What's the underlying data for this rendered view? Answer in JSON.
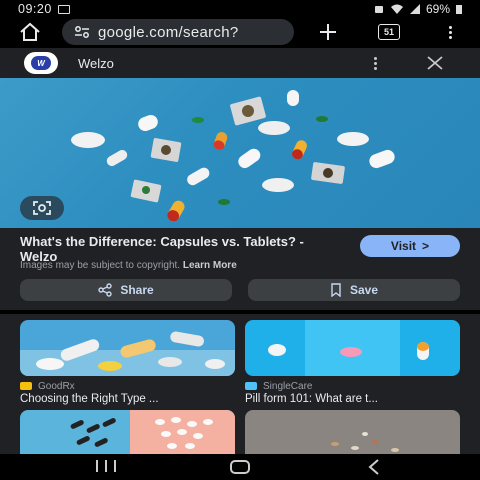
{
  "status_bar": {
    "time": "09:20",
    "battery": "69%"
  },
  "browser": {
    "url": "google.com/search?",
    "tab_count": "51",
    "new_tab_icon": "plus-icon",
    "home_icon": "home-icon"
  },
  "source_header": {
    "site_name": "Welzo",
    "logo_text": "W"
  },
  "result": {
    "title": "What's the Difference: Capsules vs. Tablets? - Welzo",
    "visit_label": "Visit",
    "visit_icon": ">",
    "copyright_notice": "Images may be subject to copyright.",
    "learn_more": "Learn More",
    "share_label": "Share",
    "save_label": "Save"
  },
  "related": [
    {
      "source": "GoodRx",
      "title": "Choosing the Right Type ...",
      "source_color": "#f4c20d"
    },
    {
      "source": "SingleCare",
      "title": "Pill form 101: What are t...",
      "source_color": "#4fc3f7"
    },
    {
      "source": "",
      "title": ""
    },
    {
      "source": "",
      "title": ""
    }
  ],
  "colors": {
    "accent": "#8ab4f8",
    "panel": "#202124",
    "hero_bg": "#2d8ec0"
  }
}
